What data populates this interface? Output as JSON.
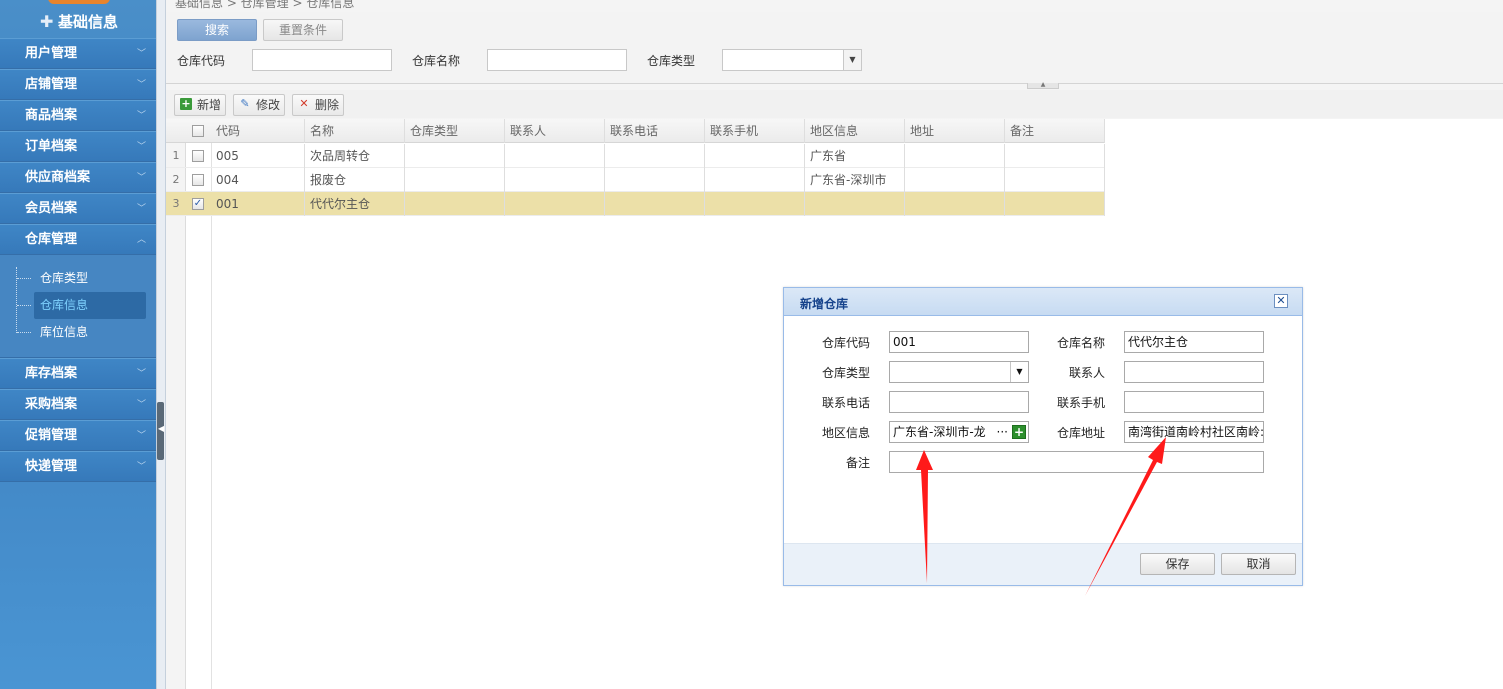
{
  "sidebar": {
    "title": "基础信息",
    "menu": [
      {
        "label": "用户管理"
      },
      {
        "label": "店铺管理"
      },
      {
        "label": "商品档案"
      },
      {
        "label": "订单档案"
      },
      {
        "label": "供应商档案"
      },
      {
        "label": "会员档案"
      },
      {
        "label": "仓库管理"
      }
    ],
    "submenu": [
      {
        "label": "仓库类型"
      },
      {
        "label": "仓库信息"
      },
      {
        "label": "库位信息"
      }
    ],
    "menu_after": [
      {
        "label": "库存档案"
      },
      {
        "label": "采购档案"
      },
      {
        "label": "促销管理"
      },
      {
        "label": "快递管理"
      }
    ]
  },
  "breadcrumb": "基础信息 > 仓库管理 > 仓库信息",
  "search": {
    "search_label": "搜索",
    "reset_label": "重置条件",
    "code_label": "仓库代码",
    "name_label": "仓库名称",
    "type_label": "仓库类型"
  },
  "toolbar": {
    "add_label": "新增",
    "edit_label": "修改",
    "delete_label": "删除"
  },
  "grid": {
    "columns": [
      "代码",
      "名称",
      "仓库类型",
      "联系人",
      "联系电话",
      "联系手机",
      "地区信息",
      "地址",
      "备注"
    ],
    "rows": [
      {
        "no": "1",
        "checked": false,
        "code": "005",
        "name": "次品周转仓",
        "region": "广东省"
      },
      {
        "no": "2",
        "checked": false,
        "code": "004",
        "name": "报废仓",
        "region": "广东省-深圳市"
      },
      {
        "no": "3",
        "checked": true,
        "code": "001",
        "name": "代代尔主仓",
        "region": ""
      }
    ]
  },
  "dialog": {
    "title": "新增仓库",
    "code_label": "仓库代码",
    "code_value": "001",
    "name_label": "仓库名称",
    "name_value": "代代尔主仓",
    "type_label": "仓库类型",
    "contact_label": "联系人",
    "phone_label": "联系电话",
    "mobile_label": "联系手机",
    "region_label": "地区信息",
    "region_value": "广东省-深圳市-龙",
    "address_label": "仓库地址",
    "address_value": "南湾街道南岭村社区南岭:",
    "remark_label": "备注",
    "save_label": "保存",
    "cancel_label": "取消"
  },
  "colors": {
    "sidebar": "#3d7fbd",
    "selected_row": "#ece0a8",
    "arrow": "#ff1a1a"
  }
}
